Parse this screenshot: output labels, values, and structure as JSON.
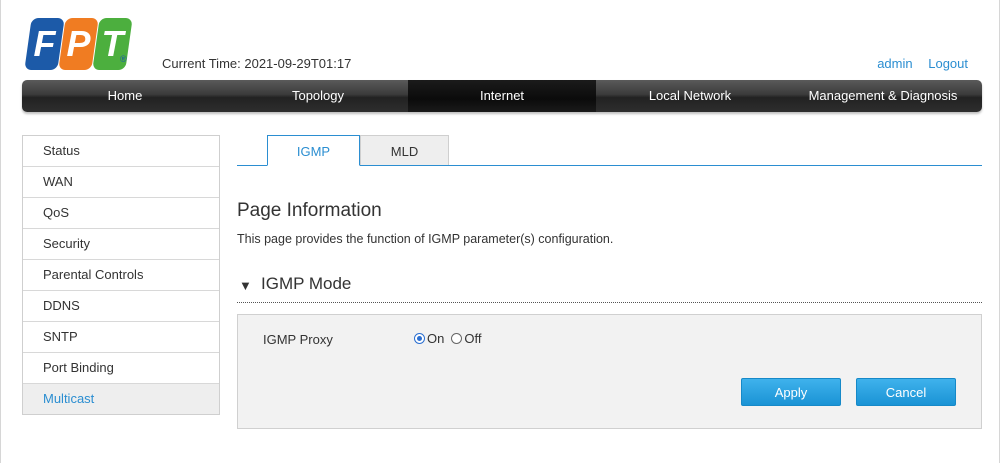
{
  "brand": {
    "letters": [
      "F",
      "P",
      "T"
    ],
    "reg_mark": "®",
    "colors": [
      "#1c5aa8",
      "#f07c22",
      "#4caf3e"
    ]
  },
  "header": {
    "current_time": "Current Time: 2021-09-29T01:17",
    "user": "admin",
    "logout": "Logout"
  },
  "nav": {
    "items": [
      {
        "label": "Home"
      },
      {
        "label": "Topology"
      },
      {
        "label": "Internet"
      },
      {
        "label": "Local Network"
      },
      {
        "label": "Management & Diagnosis"
      }
    ],
    "active": "Internet"
  },
  "sidebar": {
    "items": [
      {
        "label": "Status"
      },
      {
        "label": "WAN"
      },
      {
        "label": "QoS"
      },
      {
        "label": "Security"
      },
      {
        "label": "Parental Controls"
      },
      {
        "label": "DDNS"
      },
      {
        "label": "SNTP"
      },
      {
        "label": "Port Binding"
      },
      {
        "label": "Multicast"
      }
    ],
    "active": "Multicast"
  },
  "tabs": {
    "items": [
      {
        "label": "IGMP"
      },
      {
        "label": "MLD"
      }
    ],
    "active": "IGMP"
  },
  "page": {
    "title": "Page Information",
    "description": "This page provides the function of IGMP parameter(s) configuration."
  },
  "section": {
    "toggle_icon": "triangle-down-icon",
    "title": "IGMP Mode",
    "field_label": "IGMP Proxy",
    "options": [
      {
        "label": "On",
        "checked": true
      },
      {
        "label": "Off",
        "checked": false
      }
    ],
    "apply_label": "Apply",
    "cancel_label": "Cancel"
  },
  "accent_color": "#2b8ed1"
}
